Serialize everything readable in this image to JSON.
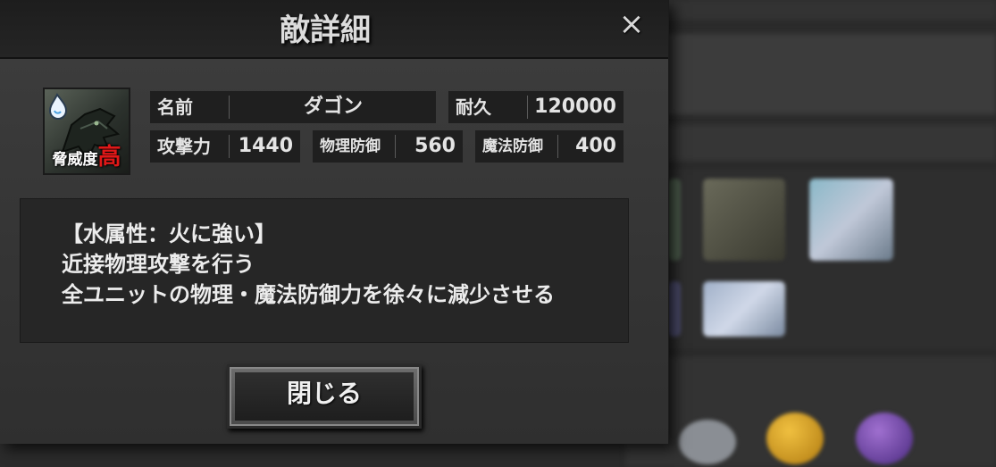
{
  "dialog": {
    "title": "敵詳細",
    "close_icon": "×",
    "close_button_label": "閉じる"
  },
  "enemy": {
    "portrait_icon": "water-dragon-portrait",
    "threat_label": "脅威度",
    "threat_level": "高",
    "threat_color": "#e01818",
    "stats": {
      "name_label": "名前",
      "name_value": "ダゴン",
      "durability_label": "耐久",
      "durability_value": "120000",
      "attack_label": "攻撃力",
      "attack_value": "1440",
      "phys_def_label": "物理防御",
      "phys_def_value": "560",
      "mag_def_label": "魔法防御",
      "mag_def_value": "400"
    },
    "description": [
      "【水属性：火に強い】",
      "近接物理攻撃を行う",
      "全ユニットの物理・魔法防御力を徐々に減少させる"
    ]
  }
}
